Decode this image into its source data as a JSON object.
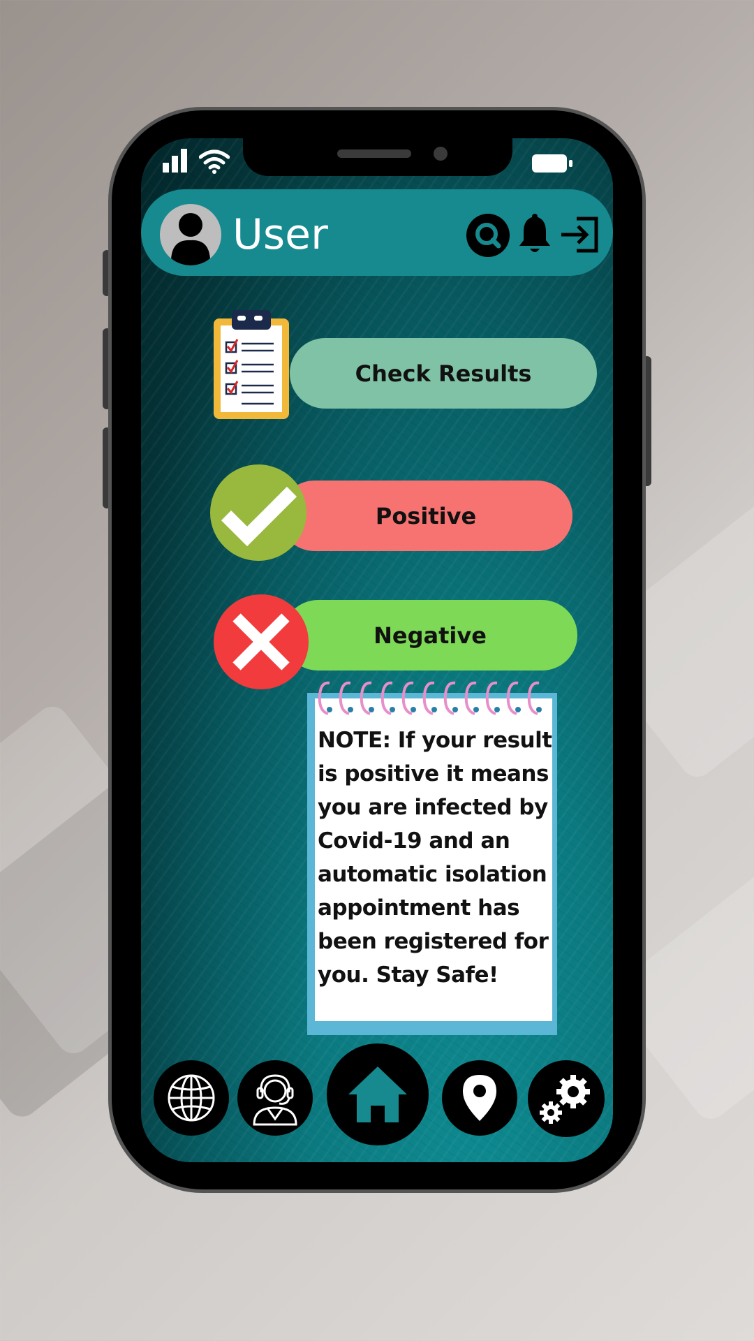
{
  "header": {
    "user_label": "User"
  },
  "actions": {
    "check_results": "Check Results",
    "positive": "Positive",
    "negative": "Negative"
  },
  "note": {
    "text": "NOTE: If your result is positive it means you are infected by Covid-19 and an automatic isolation appointment has been registered for you. Stay Safe!"
  },
  "icons": {
    "avatar": "user-avatar-icon",
    "search": "search-icon",
    "notifications": "bell-icon",
    "logout": "logout-icon",
    "check_results": "clipboard-checklist-icon",
    "positive": "checkmark-icon",
    "negative": "x-mark-icon",
    "nav": [
      "globe-icon",
      "support-agent-icon",
      "home-icon",
      "location-pin-icon",
      "settings-gears-icon"
    ]
  },
  "colors": {
    "header": "#168a8e",
    "check_results": "#80c2a5",
    "positive": "#f77372",
    "negative": "#7ed957",
    "note_border": "#5cb6d6"
  }
}
